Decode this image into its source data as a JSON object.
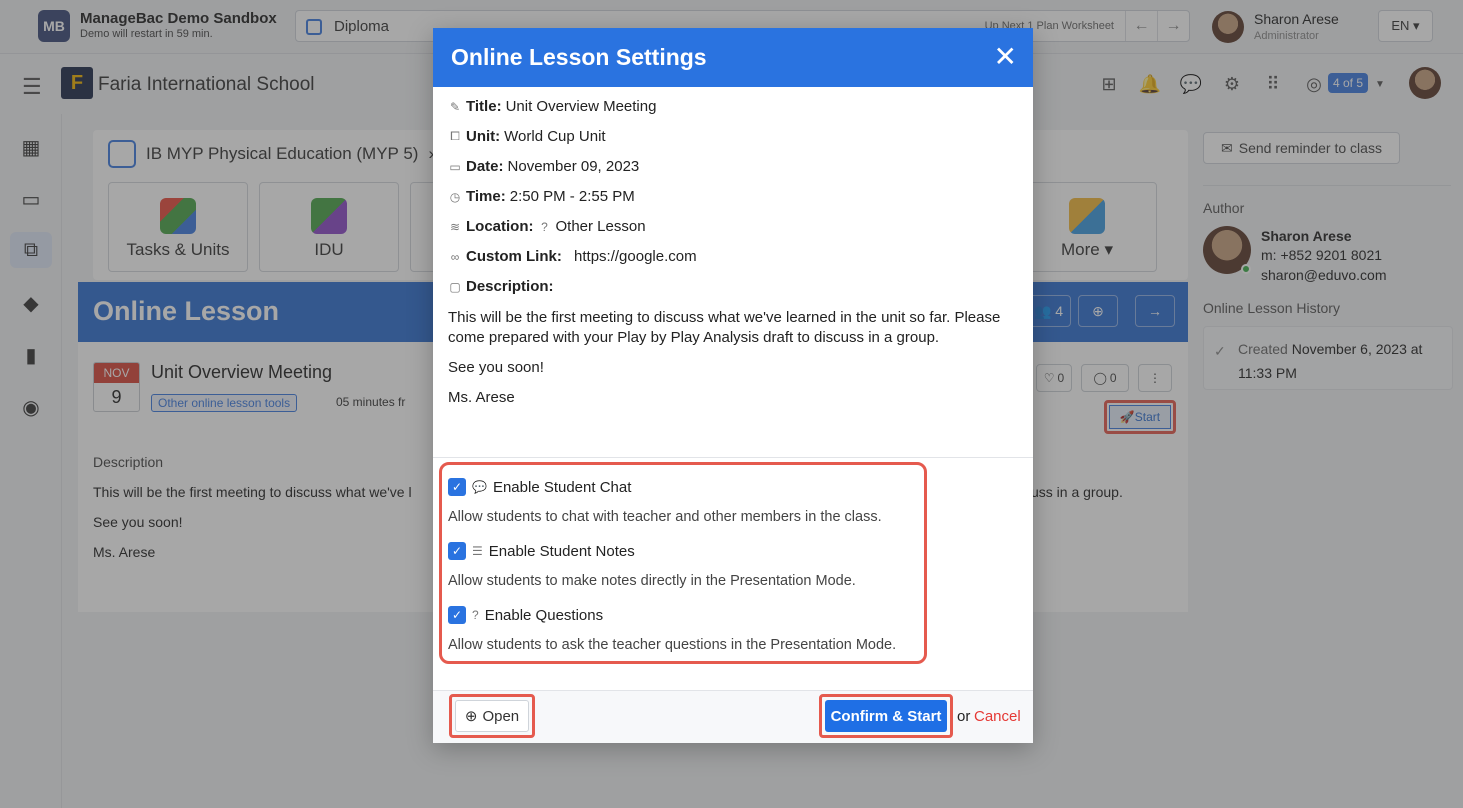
{
  "topbar": {
    "logo_text": "MB",
    "sandbox_title": "ManageBac Demo Sandbox",
    "sandbox_sub": "Demo will restart in 59 min.",
    "program": "Diploma",
    "up_next": "Up Next 1  Plan Worksheet",
    "user_name": "Sharon Arese",
    "user_role": "Administrator",
    "lang": "EN ▾"
  },
  "header": {
    "school_logo": "F",
    "school_name": "Faria International School",
    "badge": "4 of 5"
  },
  "course": {
    "breadcrumb": "IB MYP Physical Education (MYP 5)",
    "tiles": [
      {
        "label": "Tasks & Units"
      },
      {
        "label": "IDU"
      },
      {
        "label": "More ▾"
      }
    ]
  },
  "banner": {
    "title": "Online Lesson",
    "members_count": "4"
  },
  "lesson": {
    "month": "NOV",
    "day": "9",
    "title": "Unit Overview Meeting",
    "tag": "Other online lesson tools",
    "time": "05 minutes fr",
    "likes": "0",
    "comments": "0",
    "start": "Start",
    "description_heading": "Description",
    "description_line1_left": "This will be the first meeting to discuss what we've l",
    "description_line1_right": "cuss in a group.",
    "description_line2": "See you soon!",
    "description_line3": "Ms. Arese"
  },
  "right": {
    "remind": "Send reminder to class",
    "author_label": "Author",
    "author_name": "Sharon Arese",
    "author_phone": "m: +852 9201 8021",
    "author_email": "sharon@eduvo.com",
    "history_label": "Online Lesson History",
    "history_created_prefix": "Created",
    "history_created_date": "November 6, 2023 at 11:33 PM"
  },
  "modal": {
    "title": "Online Lesson Settings",
    "fields": {
      "title_label": "Title:",
      "title_value": "Unit Overview Meeting",
      "unit_label": "Unit:",
      "unit_value": "World Cup Unit",
      "date_label": "Date:",
      "date_value": "November 09, 2023",
      "time_label": "Time:",
      "time_value": "2:50 PM - 2:55 PM",
      "location_label": "Location:",
      "location_value": "Other Lesson",
      "link_label": "Custom Link:",
      "link_value": "https://google.com",
      "desc_label": "Description:"
    },
    "description": [
      "This will be the first meeting to discuss what we've learned in the unit so far. Please",
      "come prepared with your Play by Play Analysis draft to discuss in a group.",
      "See you soon!",
      "Ms. Arese"
    ],
    "options": [
      {
        "label": "Enable Student Chat",
        "desc": "Allow students to chat with teacher and other members in the class."
      },
      {
        "label": "Enable Student Notes",
        "desc": "Allow students to make notes directly in the Presentation Mode."
      },
      {
        "label": "Enable Questions",
        "desc": "Allow students to ask the teacher questions in the Presentation Mode."
      }
    ],
    "open_label": "Open",
    "confirm_label": "Confirm & Start",
    "or_label": "or",
    "cancel_label": "Cancel"
  },
  "colors": {
    "primary": "#2a73e0",
    "highlight": "#e55a4e",
    "cancel": "#e53935"
  }
}
